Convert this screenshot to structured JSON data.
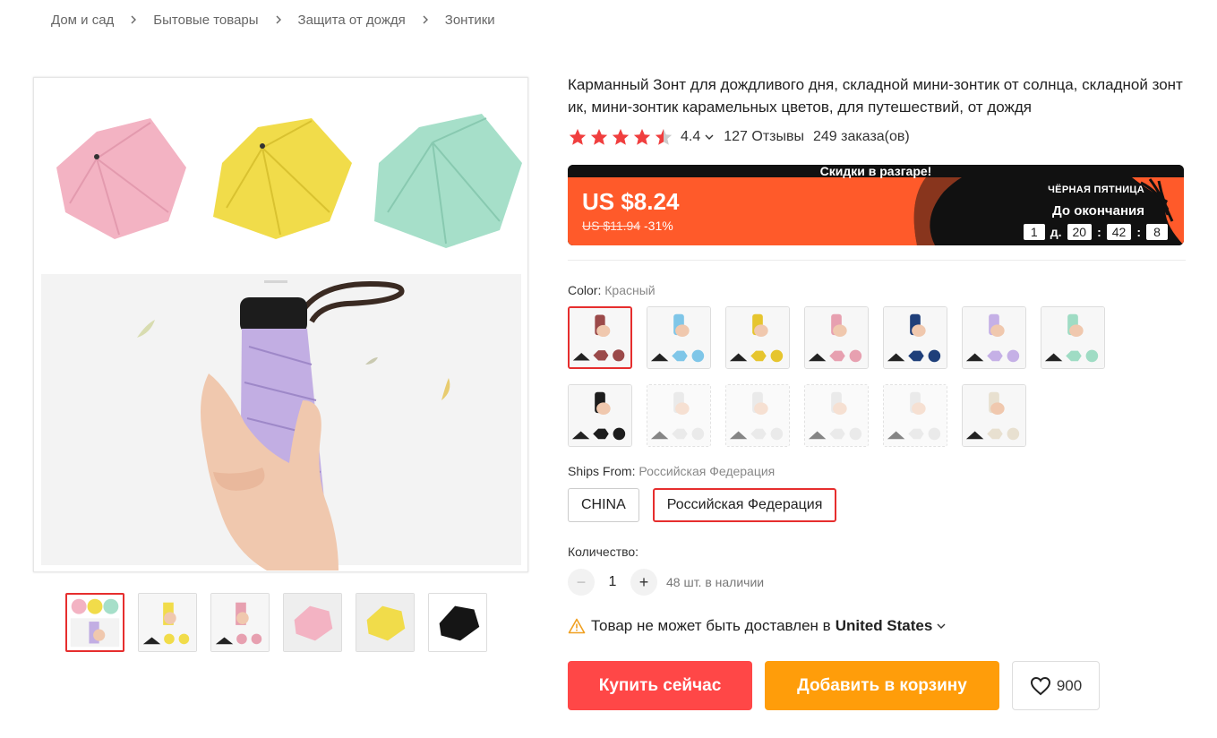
{
  "breadcrumb": [
    "Дом и сад",
    "Бытовые товары",
    "Защита от дождя",
    "Зонтики"
  ],
  "product": {
    "title": "Карманный Зонт для дождливого дня, складной мини-зонтик от солнца, складной зонтик, мини-зонтик карамельных цветов, для путешествий, от дождя",
    "rating": "4.4",
    "reviews": "127 Отзывы",
    "orders": "249 заказа(ов)"
  },
  "promo": {
    "banner_title": "Скидки в разгаре!",
    "price": "US $8.24",
    "old_price": "US $11.94",
    "discount": "-31%",
    "event": "ЧЁРНАЯ ПЯТНИЦА",
    "until": "До окончания",
    "countdown": {
      "days": "1",
      "days_unit": "д.",
      "hours": "20",
      "minutes": "42",
      "seconds": "8"
    },
    "colors": {
      "orange": "#ff5a2a",
      "dark": "#111111"
    }
  },
  "color": {
    "label": "Color:",
    "selected": "Красный",
    "swatches": [
      {
        "name": "red",
        "hex": "#9b4a4a",
        "state": "selected"
      },
      {
        "name": "light-blue",
        "hex": "#7fc6e8",
        "state": "normal"
      },
      {
        "name": "yellow",
        "hex": "#e6c52e",
        "state": "normal"
      },
      {
        "name": "pink",
        "hex": "#e7a0b0",
        "state": "normal"
      },
      {
        "name": "navy",
        "hex": "#1f3f7a",
        "state": "normal"
      },
      {
        "name": "lavender",
        "hex": "#c5b0e6",
        "state": "normal"
      },
      {
        "name": "mint",
        "hex": "#9fdcc4",
        "state": "normal"
      },
      {
        "name": "black",
        "hex": "#1d1d1d",
        "state": "normal"
      },
      {
        "name": "gray-1",
        "hex": "#d9d9d9",
        "state": "disabled"
      },
      {
        "name": "gray-2",
        "hex": "#d9d9d9",
        "state": "disabled"
      },
      {
        "name": "gray-3",
        "hex": "#d9d9d9",
        "state": "disabled"
      },
      {
        "name": "gray-4",
        "hex": "#d9d9d9",
        "state": "disabled"
      },
      {
        "name": "beige",
        "hex": "#e8e0d0",
        "state": "normal"
      }
    ]
  },
  "ships": {
    "label": "Ships From:",
    "selected": "Российская Федерация",
    "options": [
      "CHINA",
      "Российская Федерация"
    ]
  },
  "quantity": {
    "label": "Количество:",
    "value": "1",
    "stock": "48 шт. в наличии"
  },
  "delivery": {
    "text": "Товар не может быть доставлен в",
    "country": "United States"
  },
  "actions": {
    "buy": "Купить сейчас",
    "cart": "Добавить в корзину",
    "wishlist_count": "900"
  },
  "gallery": {
    "thumbnails": [
      "umbrellas-collage",
      "yellow-umbrella-in-hand",
      "pink-umbrella-in-hand",
      "pink-umbrella-open",
      "yellow-umbrella-open",
      "black-umbrella-open"
    ]
  },
  "theme": {
    "accent_red": "#ff4747",
    "accent_orange": "#ff9d0a",
    "star": "#f03e3e"
  }
}
